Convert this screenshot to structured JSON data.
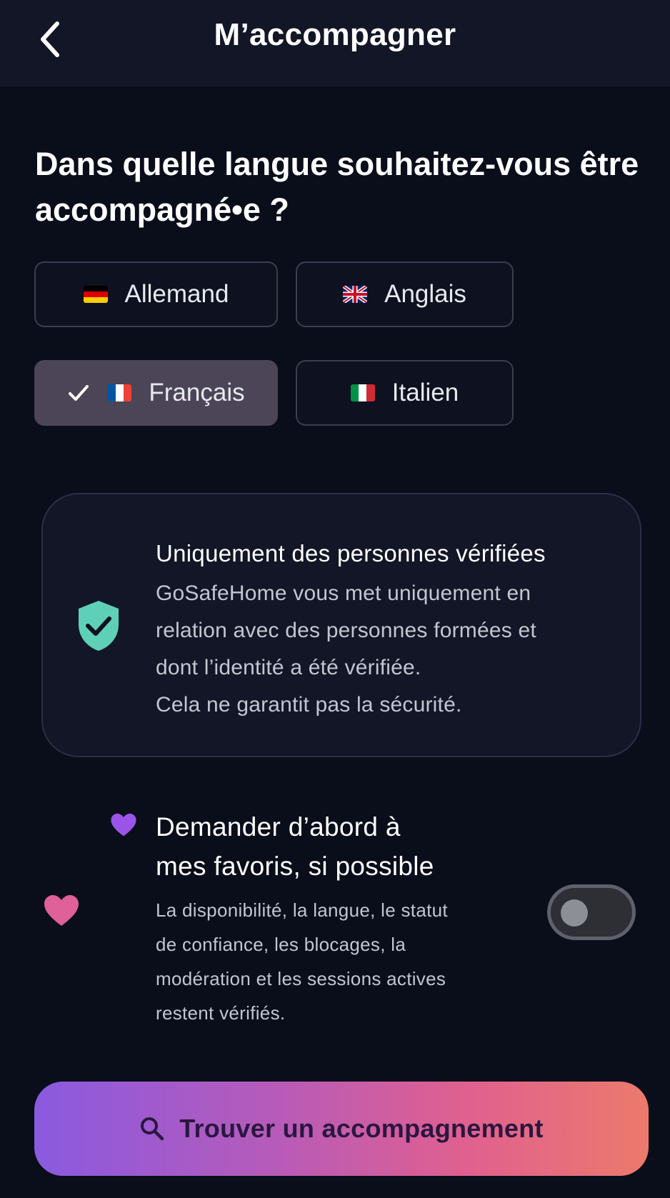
{
  "header": {
    "title": "M’accompagner",
    "back_icon": "chevron-left-icon"
  },
  "question": "Dans quelle langue souhaitez-vous être accompagné•e ?",
  "languages": [
    {
      "label": "Allemand",
      "flag": "flag-de-icon",
      "selected": false
    },
    {
      "label": "Anglais",
      "flag": "flag-gb-icon",
      "selected": false
    },
    {
      "label": "Français",
      "flag": "flag-fr-icon",
      "selected": true
    },
    {
      "label": "Italien",
      "flag": "flag-it-icon",
      "selected": false
    }
  ],
  "info_card": {
    "icon": "shield-check-icon",
    "title": "Uniquement des personnes vérifiées",
    "lines": [
      "GoSafeHome vous met uniquement en",
      "relation avec des personnes formées et",
      "dont l’identité a été vérifiée.",
      "Cela ne garantit pas la sécurité."
    ]
  },
  "favorites": {
    "title_lines": [
      "Demander d’abord à",
      "mes favoris, si possible"
    ],
    "text_lines": [
      "La disponibilité, la langue, le statut",
      "de confiance, les blocages, la",
      "modération et les sessions actives",
      "restent vérifiés."
    ],
    "toggle_on": false
  },
  "cta": {
    "label": "Trouver un accompagnement",
    "icon": "search-icon"
  },
  "colors": {
    "background": "#0a0d1a",
    "header": "#121626",
    "selected_chip": "#4b4557",
    "shield": "#5fd0b8",
    "heart": "#e0609a",
    "cta_start": "#8a5ae0",
    "cta_end": "#ec7a6c"
  }
}
